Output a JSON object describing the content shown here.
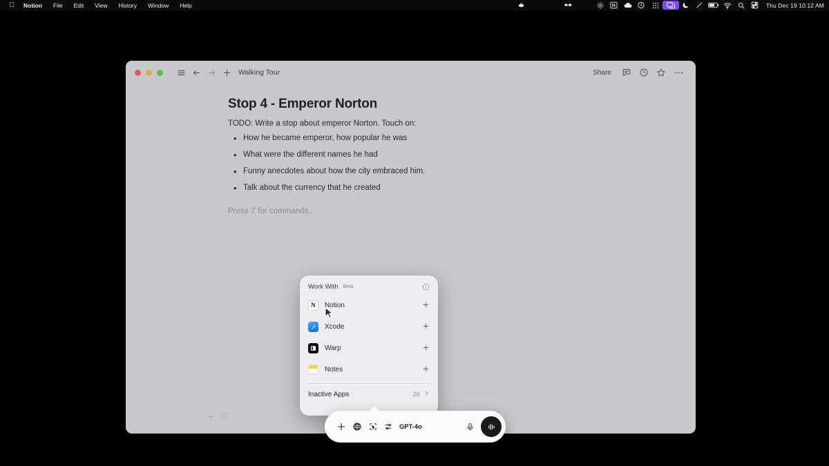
{
  "menubar": {
    "apple_icon": "apple-logo",
    "app_name": "Notion",
    "items": [
      "File",
      "Edit",
      "View",
      "History",
      "Window",
      "Help"
    ],
    "status_icons": [
      "coffee-icon",
      "glasses-icon",
      "gear-icon",
      "notion-menu-icon",
      "cloud-icon",
      "timer-icon",
      "grid-apps-icon",
      "screen-mirroring-icon",
      "moon-dnd-icon",
      "diagonal-line-icon",
      "battery-icon",
      "wifi-icon",
      "search-icon",
      "control-center-icon"
    ],
    "clock": "Thu Dec 19  10:12 AM"
  },
  "window": {
    "title": "Walking Tour",
    "traffic_lights": [
      "close-red",
      "minimize-yellow",
      "maximize-green"
    ],
    "nav": {
      "sidebar_icon": "hamburger-menu-icon",
      "back_icon": "arrow-left-icon",
      "forward_icon": "arrow-right-icon",
      "new_page_icon": "plus-icon"
    },
    "actions": {
      "share_label": "Share",
      "comment_icon": "comment-bubble-icon",
      "history_icon": "clock-history-icon",
      "favorite_icon": "star-icon",
      "more_icon": "ellipsis-icon"
    }
  },
  "document": {
    "heading": "Stop 4 - Emperor Norton",
    "intro": "TODO: Write a stop about emperor Norton. Touch on:",
    "bullets": [
      "How he became emperor, how popular he was",
      "What were the different names he had",
      "Funny anecdotes about how the city embraced him.",
      "Talk about the currency that he created"
    ],
    "placeholder": "Press '/' for commands...",
    "handles": {
      "add_icon": "plus-icon",
      "drag_icon": "drag-grip-icon"
    }
  },
  "popup": {
    "title": "Work With",
    "badge": "Beta",
    "info_icon": "info-circle-icon",
    "apps": [
      {
        "name": "Notion",
        "icon": "notion-app-icon",
        "action_icon": "plus-icon"
      },
      {
        "name": "Xcode",
        "icon": "xcode-app-icon",
        "action_icon": "plus-icon"
      },
      {
        "name": "Warp",
        "icon": "warp-app-icon",
        "action_icon": "plus-icon"
      },
      {
        "name": "Notes",
        "icon": "notes-app-icon",
        "action_icon": "plus-icon"
      }
    ],
    "footer": {
      "label": "Inactive Apps",
      "count": "26",
      "chevron_icon": "chevron-right-icon"
    }
  },
  "chatbar": {
    "add_icon": "plus-icon",
    "web_icon": "globe-icon",
    "screen_icon": "cursor-select-icon",
    "tune_icon": "sliders-icon",
    "model_label": "GPT-4o",
    "mic_icon": "microphone-icon",
    "voice_icon": "voice-waveform-icon"
  },
  "colors": {
    "desktop": "#000000",
    "window_bg": "#c8c8cb",
    "popup_bg": "#eeeef0",
    "chatbar_bg": "#fbfbfb",
    "menubar_highlight": "#7b4dff"
  }
}
